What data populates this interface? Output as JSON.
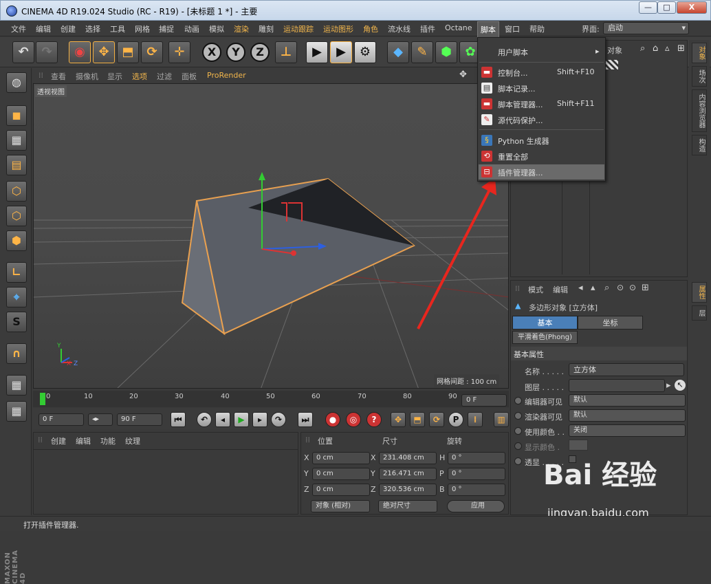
{
  "window": {
    "title": "CINEMA 4D R19.024 Studio (RC - R19) - [未标题 1 *] - 主要",
    "min": "—",
    "max": "□",
    "close": "X"
  },
  "menu": [
    "文件",
    "编辑",
    "创建",
    "选择",
    "工具",
    "网格",
    "捕捉",
    "动画",
    "模拟",
    "渲染",
    "雕刻",
    "运动跟踪",
    "运动图形",
    "角色",
    "流水线",
    "插件",
    "Octane",
    "脚本",
    "窗口",
    "帮助"
  ],
  "interface": {
    "label": "界面:",
    "value": "启动"
  },
  "viewport": {
    "menu": [
      "查看",
      "摄像机",
      "显示",
      "选项",
      "过滤",
      "面板",
      "ProRender"
    ],
    "tag": "透视视图",
    "grid_label": "网格间距 : 100 cm",
    "axes": {
      "y": "Y",
      "x": "X",
      "z": "Z"
    }
  },
  "timeline": {
    "ticks": [
      "0",
      "10",
      "20",
      "30",
      "40",
      "50",
      "60",
      "70",
      "80",
      "90"
    ],
    "frame": "0 F"
  },
  "transport": {
    "start": "0 F",
    "end": "90 F"
  },
  "bottom_panel": {
    "menu": [
      "创建",
      "编辑",
      "功能",
      "纹理"
    ]
  },
  "coords": {
    "headers": [
      "位置",
      "尺寸",
      "旋转"
    ],
    "pos": [
      {
        "axis": "X",
        "val": "0 cm"
      },
      {
        "axis": "Y",
        "val": "0 cm"
      },
      {
        "axis": "Z",
        "val": "0 cm"
      }
    ],
    "size": [
      {
        "axis": "X",
        "val": "231.408 cm"
      },
      {
        "axis": "Y",
        "val": "216.471 cm"
      },
      {
        "axis": "Z",
        "val": "320.536 cm"
      }
    ],
    "rot": [
      {
        "axis": "H",
        "val": "0 °"
      },
      {
        "axis": "P",
        "val": "0 °"
      },
      {
        "axis": "B",
        "val": "0 °"
      }
    ],
    "mode": "对象 (相对)",
    "size_mode": "绝对尺寸",
    "apply": "应用"
  },
  "object_manager": {
    "header_fragment": "对象"
  },
  "attributes": {
    "menu": [
      "模式",
      "编辑"
    ],
    "object": "多边形对象 [立方体]",
    "tabs": [
      "基本",
      "坐标"
    ],
    "phong": "平滑着色(Phong)",
    "section": "基本属性",
    "name_label": "名称 . . . . .",
    "name_value": "立方体",
    "layer_label": "图层 . . . . .",
    "editor_label": "编辑器可见",
    "editor_value": "默认",
    "render_label": "渲染器可见",
    "render_value": "默认",
    "color_label": "使用颜色 . .",
    "color_value": "关闭",
    "display_color_label": "显示颜色 .",
    "xray_label": "透显 . . . . ."
  },
  "right_tabs": {
    "top": [
      "对象",
      "场次",
      "内容浏览器",
      "构造"
    ],
    "bottom": [
      "属性",
      "层"
    ]
  },
  "dropdown": {
    "items": [
      {
        "label": "用户脚本",
        "shortcut": "",
        "arrow": "▸"
      },
      {
        "label": "控制台...",
        "shortcut": "Shift+F10"
      },
      {
        "label": "脚本记录...",
        "shortcut": ""
      },
      {
        "label": "脚本管理器...",
        "shortcut": "Shift+F11"
      },
      {
        "label": "源代码保护...",
        "shortcut": ""
      },
      {
        "label": "Python 生成器",
        "shortcut": ""
      },
      {
        "label": "重置全部",
        "shortcut": ""
      },
      {
        "label": "插件管理器...",
        "shortcut": ""
      }
    ]
  },
  "status": "打开插件管理器.",
  "watermark": {
    "brand": "Bai 经验",
    "url": "jingyan.baidu.com"
  },
  "maxon": "MAXON CINEMA 4D"
}
